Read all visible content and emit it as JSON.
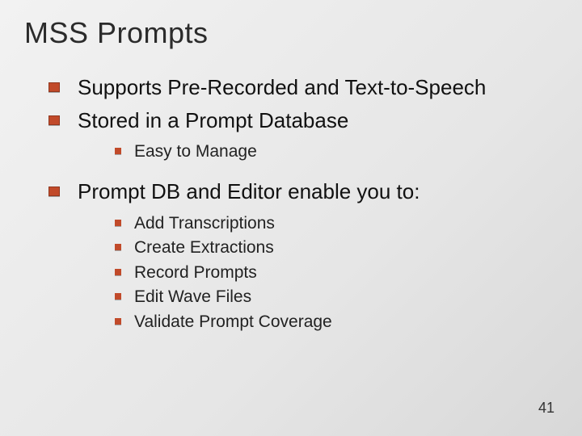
{
  "title": "MSS Prompts",
  "bullets": {
    "b0": {
      "text": "Supports Pre-Recorded and Text-to-Speech"
    },
    "b1": {
      "text": "Stored in a Prompt Database",
      "sub": {
        "s0": "Easy to Manage"
      }
    },
    "b2": {
      "text": "Prompt DB and Editor enable you to:",
      "sub": {
        "s0": "Add Transcriptions",
        "s1": "Create Extractions",
        "s2": "Record Prompts",
        "s3": "Edit Wave Files",
        "s4": "Validate Prompt Coverage"
      }
    }
  },
  "page_number": "41",
  "colors": {
    "accent": "#c14a2a"
  }
}
